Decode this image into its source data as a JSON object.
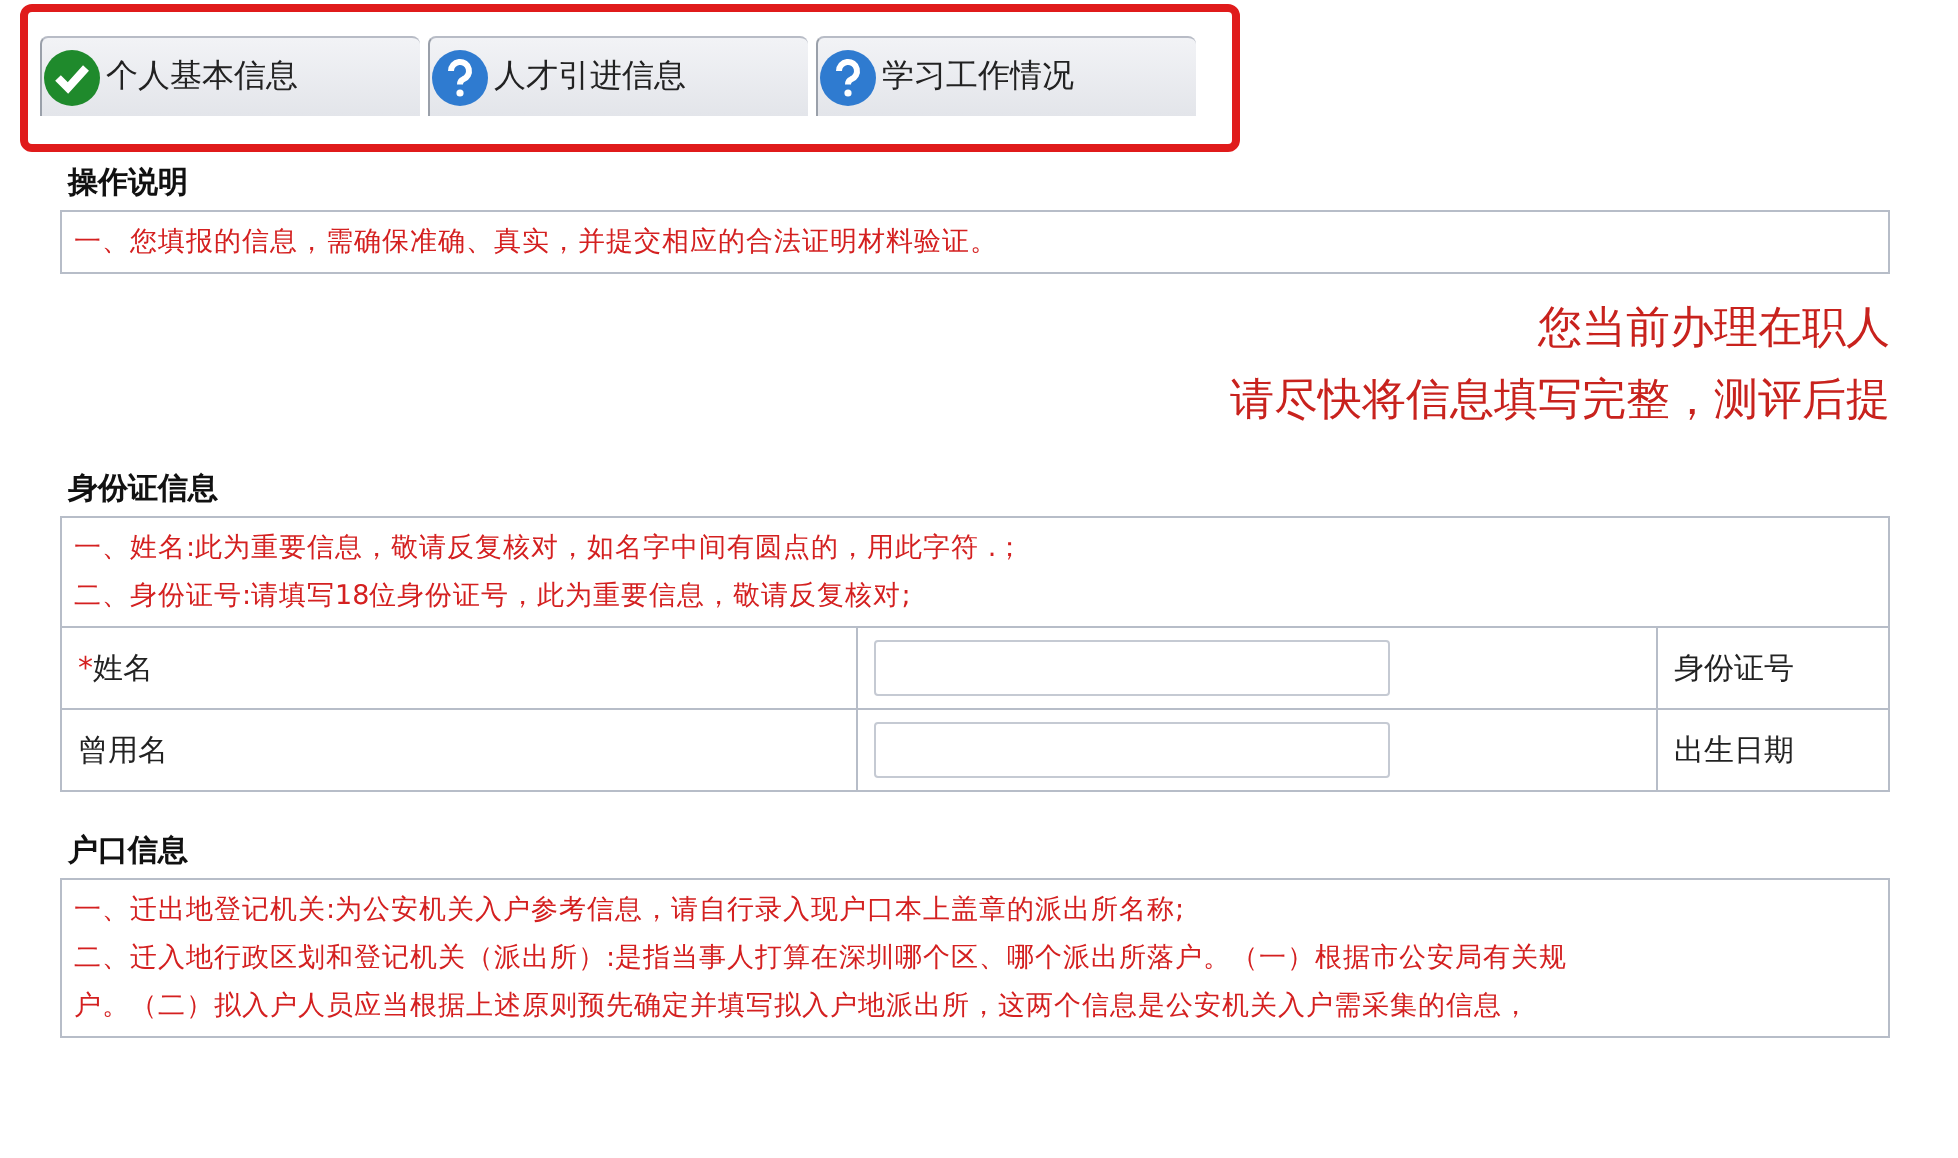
{
  "tabs": [
    {
      "label": "个人基本信息",
      "kind": "done"
    },
    {
      "label": "人才引进信息",
      "kind": "pending"
    },
    {
      "label": "学习工作情况",
      "kind": "pending"
    }
  ],
  "instructions": {
    "title": "操作说明",
    "notes": [
      "一、您填报的信息，需确保准确、真实，并提交相应的合法证明材料验证。"
    ]
  },
  "banner": [
    "您当前办理在职人",
    "请尽快将信息填写完整，测评后提"
  ],
  "id_section": {
    "title": "身份证信息",
    "notes": [
      "一、姓名:此为重要信息，敬请反复核对，如名字中间有圆点的，用此字符 .；",
      "二、身份证号:请填写18位身份证号，此为重要信息，敬请反复核对;"
    ],
    "rows": [
      {
        "required_mark": "*",
        "label": "姓名",
        "other_label": "身份证号"
      },
      {
        "label": "曾用名",
        "other_label": "出生日期"
      }
    ]
  },
  "hukou_section": {
    "title": "户口信息",
    "notes": [
      "一、迁出地登记机关:为公安机关入户参考信息，请自行录入现户口本上盖章的派出所名称;",
      "二、迁入地行政区划和登记机关（派出所）:是指当事人打算在深圳哪个区、哪个派出所落户。（一）根据市公安局有关规",
      "户。（二）拟入户人员应当根据上述原则预先确定并填写拟入户地派出所，这两个信息是公安机关入户需采集的信息，"
    ]
  }
}
